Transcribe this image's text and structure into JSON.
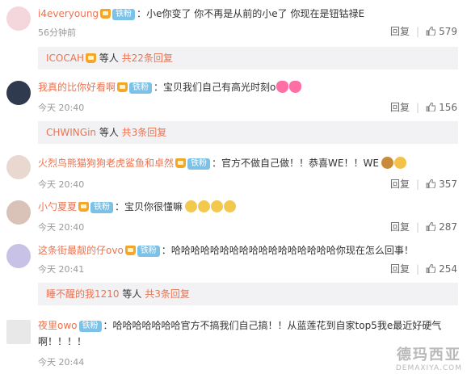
{
  "badge_label": "铁粉",
  "reply_label": "回复",
  "comments": [
    {
      "username": "i4everyoung",
      "text": "小e你变了 你不再是从前的小e了 你现在是钮钴禄E",
      "time": "56分钟前",
      "likes": "579",
      "sub": {
        "names": "ICOCAH",
        "middle": " 等人 ",
        "count": "共22条回复"
      }
    },
    {
      "username": "我真的比你好看啊",
      "text": "宝贝我们自己有高光时刻o",
      "time": "今天 20:40",
      "likes": "156",
      "sub": {
        "names": "CHWINGin",
        "middle": " 等人 ",
        "count": "共3条回复"
      }
    },
    {
      "username": "火烈鸟熊猫狗狗老虎鲨鱼和卓然",
      "text": "官方不做自己做！！恭喜WE！！WE",
      "time": "今天 20:40",
      "likes": "357"
    },
    {
      "username": "小勺夏夏",
      "text": "宝贝你很懂嘛",
      "time": "今天 20:40",
      "likes": "287"
    },
    {
      "username": "这条街最靓的仔ovo",
      "text": "哈哈哈哈哈哈哈哈哈哈哈哈哈哈哈哈哈你现在怎么回事！",
      "time": "今天 20:41",
      "likes": "254",
      "sub": {
        "names": "睡不醒的我1210",
        "middle": " 等人 ",
        "count": "共3条回复"
      }
    },
    {
      "username": "夜里owo",
      "text": "哈哈哈哈哈哈哈官方不搞我们自己搞！！从蓝莲花到自家top5我e最近好硬气",
      "text2": "啊！！！！",
      "time": "今天 20:44"
    }
  ],
  "watermark": {
    "line1": "德玛西亚",
    "line2": "DEMAXIYA.COM"
  },
  "colors": {
    "username": "#eb7350",
    "badge": "#7cc2e8",
    "subreply_bg": "#f2f2f5"
  }
}
